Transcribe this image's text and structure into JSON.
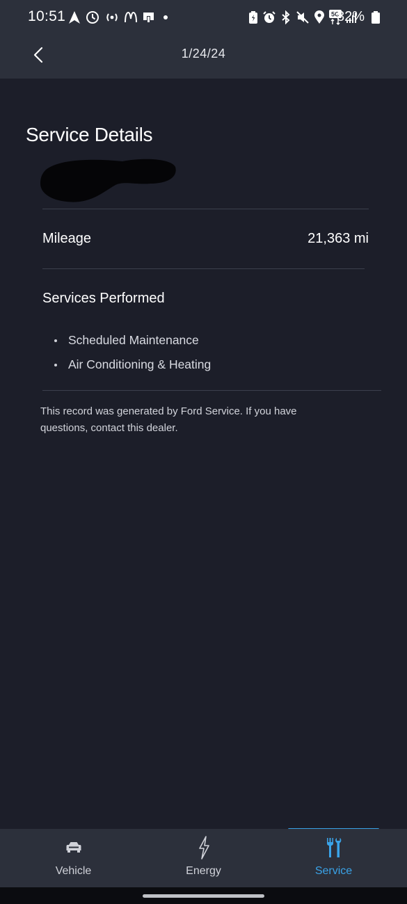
{
  "status_bar": {
    "time": "10:51",
    "battery_percent": "82%",
    "network_badge": "5G",
    "left_icons": [
      "navigation-icon",
      "clock-icon",
      "broadcast-icon",
      "mcdonalds-icon",
      "store-icon",
      "dot-icon"
    ],
    "right_icons": [
      "battery-saver-icon",
      "alarm-icon",
      "bluetooth-icon",
      "mute-icon",
      "location-icon",
      "5g-icon",
      "signal-icon",
      "battery-icon"
    ]
  },
  "nav": {
    "title": "1/24/24",
    "back_icon": "chevron-left-icon"
  },
  "details": {
    "title": "Service Details",
    "mileage_label": "Mileage",
    "mileage_value": "21,363 mi",
    "services_heading": "Services Performed",
    "services": [
      "Scheduled Maintenance",
      "Air Conditioning & Heating"
    ],
    "disclaimer": "This record was generated by Ford Service. If you have questions, contact this dealer."
  },
  "tabs": [
    {
      "label": "Vehicle",
      "icon": "car-icon",
      "active": false
    },
    {
      "label": "Energy",
      "icon": "lightning-icon",
      "active": false
    },
    {
      "label": "Service",
      "icon": "tools-icon",
      "active": true
    }
  ],
  "colors": {
    "background": "#1c1e29",
    "header": "#2c303b",
    "accent": "#3aa3e8",
    "text": "#ffffff",
    "divider": "#3c404d"
  }
}
